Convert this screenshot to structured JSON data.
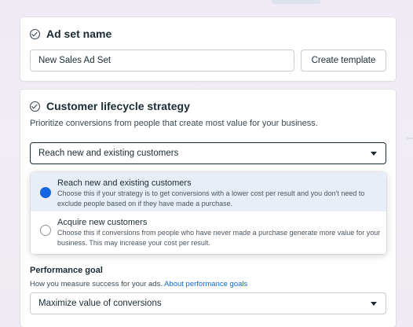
{
  "ad_set": {
    "title": "Ad set name",
    "name_value": "New Sales Ad Set",
    "create_template_label": "Create template"
  },
  "lifecycle": {
    "title": "Customer lifecycle strategy",
    "description": "Prioritize conversions from people that create most value for your business.",
    "selected_value": "Reach new and existing customers",
    "options": [
      {
        "label": "Reach new and existing customers",
        "description": "Choose this if your strategy is to get conversions with a lower cost per result and you don't need to exclude people based on if they have made a purchase.",
        "selected": true
      },
      {
        "label": "Acquire new customers",
        "description": "Choose this if conversions from people who have never made a purchase generate more value for your business. This may increase your cost per result.",
        "selected": false
      }
    ]
  },
  "performance_goal": {
    "label": "Performance goal",
    "description": "How you measure success for your ads.",
    "link_text": "About performance goals",
    "selected_value": "Maximize value of conversions"
  },
  "colors": {
    "accent": "#1467e0",
    "selected_option_bg": "#e7eef8",
    "focus_border": "#1c2b33"
  },
  "icons": [
    "check-circle-icon",
    "caret-down-icon",
    "radio-selected-icon",
    "radio-unselected-icon"
  ]
}
